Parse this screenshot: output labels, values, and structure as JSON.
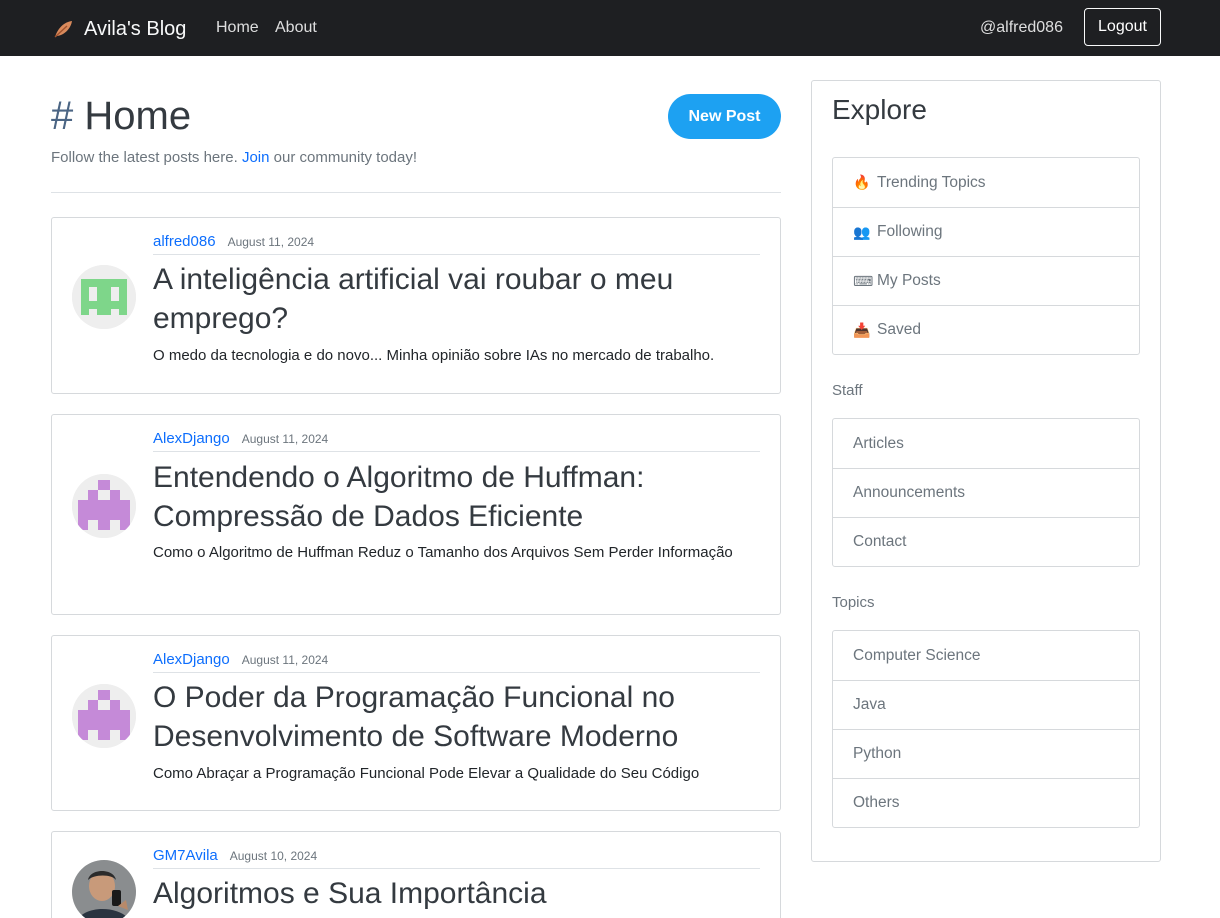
{
  "nav": {
    "brand": "Avila's Blog",
    "links": [
      "Home",
      "About"
    ],
    "user": "@alfred086",
    "logout": "Logout"
  },
  "header": {
    "hash": "#",
    "title": "Home",
    "new_post": "New Post",
    "subtitle_before": "Follow the latest posts here. ",
    "subtitle_link": "Join",
    "subtitle_after": " our community today!"
  },
  "posts": [
    {
      "author": "alfred086",
      "date": "August 11, 2024",
      "title": "A inteligência artificial vai roubar o meu emprego?",
      "description": "O medo da tecnologia e do novo... Minha opinião sobre IAs no mercado de trabalho."
    },
    {
      "author": "AlexDjango",
      "date": "August 11, 2024",
      "title": "Entendendo o Algoritmo de Huffman: Compressão de Dados Eficiente",
      "description": "Como o Algoritmo de Huffman Reduz o Tamanho dos Arquivos Sem Perder Informação"
    },
    {
      "author": "AlexDjango",
      "date": "August 11, 2024",
      "title": "O Poder da Programação Funcional no Desenvolvimento de Software Moderno",
      "description": "Como Abraçar a Programação Funcional Pode Elevar a Qualidade do Seu Código"
    },
    {
      "author": "GM7Avila",
      "date": "August 10, 2024",
      "title": "Algoritmos e Sua Importância",
      "description": ""
    }
  ],
  "sidebar": {
    "title": "Explore",
    "explore": [
      {
        "icon": "fire-icon",
        "glyph": "🔥",
        "label": "Trending Topics"
      },
      {
        "icon": "people-icon",
        "glyph": "👥",
        "label": "Following"
      },
      {
        "icon": "keyboard-icon",
        "glyph": "⌨",
        "label": "My Posts"
      },
      {
        "icon": "inbox-icon",
        "glyph": "📥",
        "label": "Saved"
      }
    ],
    "staff_label": "Staff",
    "staff": [
      "Articles",
      "Announcements",
      "Contact"
    ],
    "topics_label": "Topics",
    "topics": [
      "Computer Science",
      "Java",
      "Python",
      "Others"
    ]
  },
  "colors": {
    "navbar": "#1e1f22",
    "accent": "#1da1f2",
    "link": "#0d6efd"
  }
}
